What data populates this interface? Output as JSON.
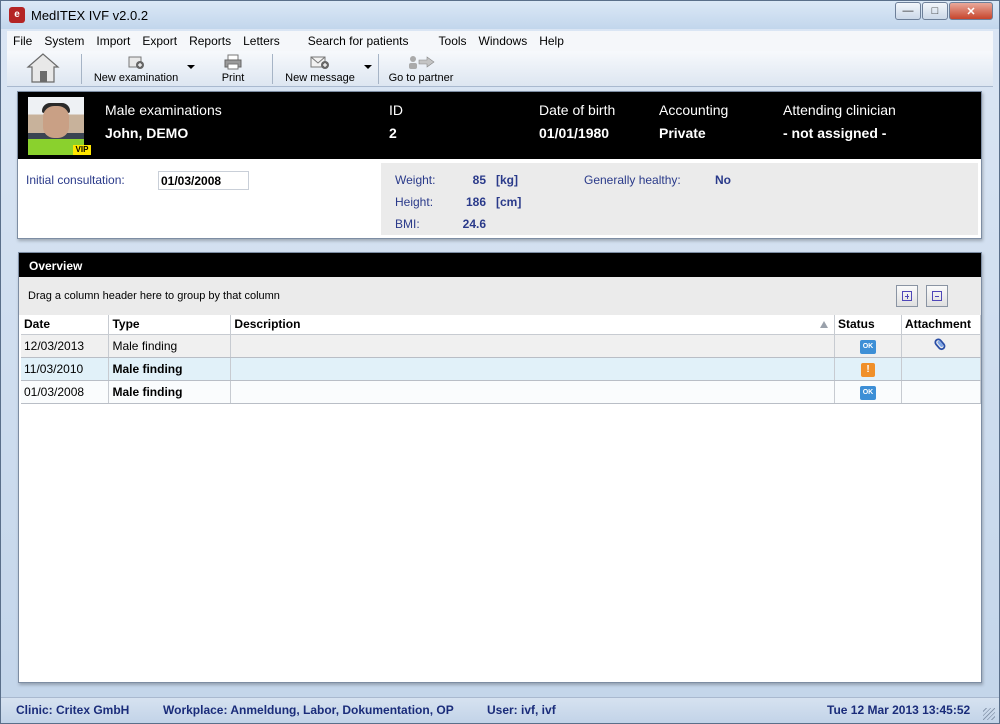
{
  "window": {
    "title": "MedITEX IVF v2.0.2",
    "app_icon": "meditex-logo-icon",
    "controls": [
      "minimize",
      "maximize",
      "close"
    ]
  },
  "menu": [
    "File",
    "System",
    "Import",
    "Export",
    "Reports",
    "Letters",
    "Search for patients",
    "Tools",
    "Windows",
    "Help"
  ],
  "toolbar": {
    "home_icon": "house-icon",
    "new_examination": "New examination",
    "print": "Print",
    "new_message": "New message",
    "go_to_partner": "Go to partner"
  },
  "patient": {
    "exam_type_label": "Male examinations",
    "name": "John, DEMO",
    "id_label": "ID",
    "id": "2",
    "dob_label": "Date of birth",
    "dob": "01/01/1980",
    "accounting_label": "Accounting",
    "accounting": "Private",
    "clinician_label": "Attending clinician",
    "clinician": "- not assigned -",
    "vip_badge": "VIP",
    "initial_consultation_label": "Initial consultation:",
    "initial_consultation": "01/03/2008",
    "weight_label": "Weight:",
    "weight": "85",
    "weight_unit": "[kg]",
    "height_label": "Height:",
    "height": "186",
    "height_unit": "[cm]",
    "bmi_label": "BMI:",
    "bmi": "24.6",
    "healthy_label": "Generally healthy:",
    "healthy": "No"
  },
  "overview": {
    "title": "Overview",
    "group_hint": "Drag a column header here to group by that column",
    "columns": [
      "Date",
      "Type",
      "Description",
      "Status",
      "Attachment"
    ],
    "rows": [
      {
        "date": "12/03/2013",
        "type": "Male finding",
        "description": "",
        "status": "OK",
        "status_icon": "ok-status-icon",
        "attachment_icon": "paperclip-icon"
      },
      {
        "date": "11/03/2010",
        "type": "Male finding",
        "description": "",
        "status": "!",
        "status_icon": "warning-status-icon",
        "attachment_icon": ""
      },
      {
        "date": "01/03/2008",
        "type": "Male finding",
        "description": "",
        "status": "OK",
        "status_icon": "ok-status-icon",
        "attachment_icon": ""
      }
    ]
  },
  "statusbar": {
    "clinic": "Clinic: Critex GmbH",
    "workplace": "Workplace: Anmeldung, Labor, Dokumentation, OP",
    "user": "User: ivf, ivf",
    "datetime": "Tue 12 Mar 2013 13:45:52"
  },
  "colors": {
    "header_bg": "#000000",
    "label_blue": "#2a3a8a",
    "selected_row": "#e1f1f9",
    "status_ok": "#3d8fd6",
    "status_warn": "#f0902a",
    "vip": "#ffe600"
  }
}
